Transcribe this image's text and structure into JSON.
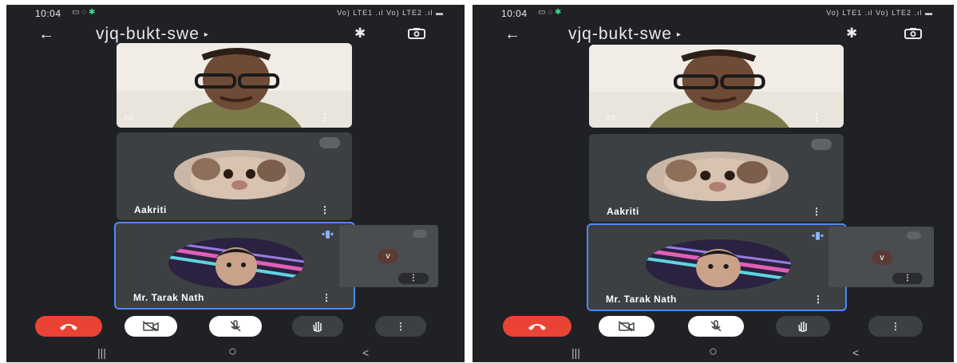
{
  "status_bar": {
    "time": "10:04",
    "right_indicators": "Vo) LTE1 .ıl Vo) LTE2 .ıl ▬"
  },
  "meeting": {
    "code": "vjq-bukt-swe",
    "caret": "▸",
    "back_icon": "←"
  },
  "participants": [
    {
      "name": "rc",
      "menu": "⋮"
    },
    {
      "name": "Aakriti",
      "menu": "⋮"
    },
    {
      "name": "Mr. Tarak Nath",
      "menu": "⋮"
    }
  ],
  "self_view": {
    "chevron": "v",
    "menu": "⋮"
  },
  "controls": {
    "more_label": "⋮"
  },
  "nav": {
    "recent": "|||",
    "home": "○",
    "back": "<"
  },
  "colors": {
    "background": "#202124",
    "tile": "#3c4043",
    "end_call": "#ea4335",
    "active_border": "#4c8bf5"
  }
}
